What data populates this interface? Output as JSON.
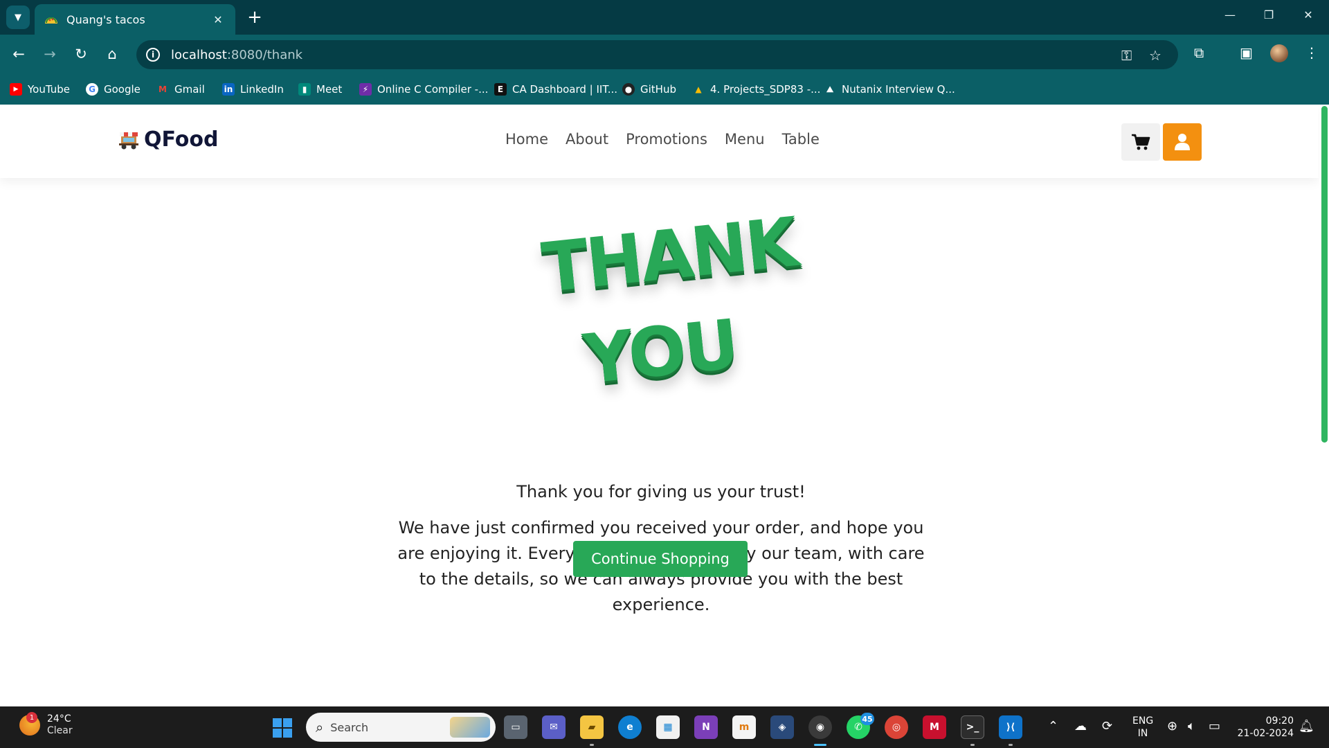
{
  "browser": {
    "tab_title": "Quang's tacos",
    "url_host": "localhost",
    "url_rest": ":8080/thank",
    "bookmarks": [
      {
        "label": "YouTube",
        "icon": "youtube-icon",
        "color": "#ff0000"
      },
      {
        "label": "Google",
        "icon": "google-icon",
        "color": "#ffffff"
      },
      {
        "label": "Gmail",
        "icon": "gmail-icon",
        "color": "#ea4335"
      },
      {
        "label": "LinkedIn",
        "icon": "linkedin-icon",
        "color": "#0a66c2"
      },
      {
        "label": "Meet",
        "icon": "meet-icon",
        "color": "#00897b"
      },
      {
        "label": "Online C Compiler -...",
        "icon": "compiler-icon",
        "color": "#6f2da8"
      },
      {
        "label": "CA Dashboard | IIT...",
        "icon": "dashboard-icon",
        "color": "#111111"
      },
      {
        "label": "GitHub",
        "icon": "github-icon",
        "color": "#222222"
      },
      {
        "label": "4. Projects_SDP83 -...",
        "icon": "drive-icon",
        "color": "#1fa463"
      },
      {
        "label": "Nutanix Interview Q...",
        "icon": "nutanix-icon",
        "color": "#ffffff"
      }
    ]
  },
  "site": {
    "brand": "QFood",
    "nav": [
      "Home",
      "About",
      "Promotions",
      "Menu",
      "Table"
    ],
    "thank_line1": "THANK",
    "thank_line2": "YOU",
    "trust": "Thank you for giving us your trust!",
    "confirm": "We have just confirmed you received your order, and hope you are enjoying it. Every item is handmade by our team, with care to the details, so we can always provide you with the best experience.",
    "continue_label": "Continue Shopping",
    "accent_green": "#28a857",
    "accent_orange": "#f39010"
  },
  "taskbar": {
    "weather_temp": "24°C",
    "weather_cond": "Clear",
    "weather_badge": "1",
    "search_label": "Search",
    "whatsapp_badge": "45",
    "lang_line1": "ENG",
    "lang_line2": "IN",
    "time": "09:20",
    "date": "21-02-2024"
  }
}
